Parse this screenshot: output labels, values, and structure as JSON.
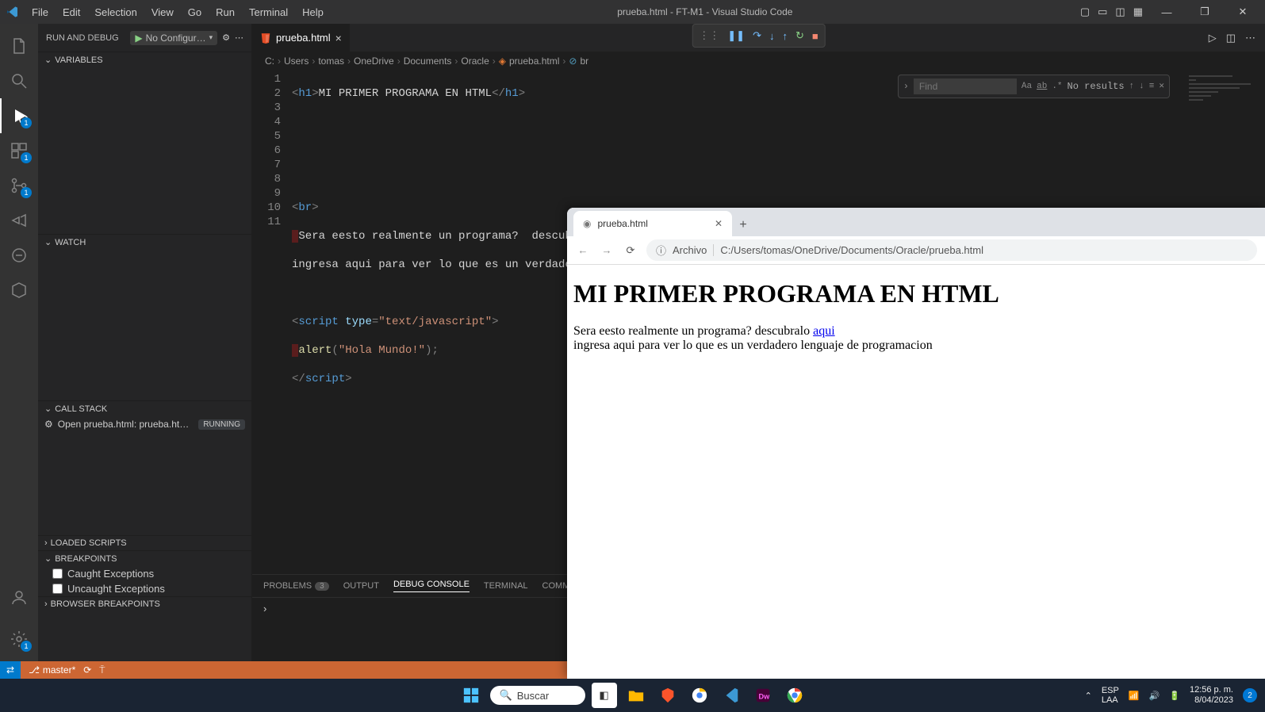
{
  "titlebar": {
    "menu": [
      "File",
      "Edit",
      "Selection",
      "View",
      "Go",
      "Run",
      "Terminal",
      "Help"
    ],
    "title": "prueba.html - FT-M1 - Visual Studio Code"
  },
  "sidebar": {
    "title": "RUN AND DEBUG",
    "config": "No Configur…",
    "sections": {
      "variables": "VARIABLES",
      "watch": "WATCH",
      "callstack": "CALL STACK",
      "callstack_item": "Open prueba.html: prueba.ht…",
      "callstack_status": "RUNNING",
      "loaded": "LOADED SCRIPTS",
      "breakpoints": "BREAKPOINTS",
      "caught": "Caught Exceptions",
      "uncaught": "Uncaught Exceptions",
      "browser_bp": "BROWSER BREAKPOINTS"
    }
  },
  "tab": {
    "name": "prueba.html"
  },
  "breadcrumb": [
    "C:",
    "Users",
    "tomas",
    "OneDrive",
    "Documents",
    "Oracle",
    "prueba.html",
    "br"
  ],
  "find": {
    "placeholder": "Find",
    "results": "No results"
  },
  "code": {
    "lines": [
      1,
      2,
      3,
      4,
      5,
      6,
      7,
      8,
      9,
      10,
      11
    ],
    "h1_text": "MI PRIMER PROGRAMA EN HTML",
    "line6_pre": "Sera eesto realmente un programa?  descubralo ",
    "href": "https://es.wikipedia.org/wiki/Python",
    "link_text": "aqui",
    "line7": "ingresa aqui para ver lo que es un verdadero lenguaje de programacion",
    "script_type": "text/javascript",
    "alert_arg": "Hola Mundo!"
  },
  "panel": {
    "problems": "PROBLEMS",
    "problems_badge": "3",
    "output": "OUTPUT",
    "debug": "DEBUG CONSOLE",
    "terminal": "TERMINAL",
    "comments": "COMMENTS"
  },
  "statusbar": {
    "branch": "master*"
  },
  "browser": {
    "tab_title": "prueba.html",
    "scheme": "Archivo",
    "url": "C:/Users/tomas/OneDrive/Documents/Oracle/prueba.html",
    "h1": "MI PRIMER PROGRAMA EN HTML",
    "p1a": "Sera eesto realmente un programa? descubralo ",
    "p1_link": "aqui",
    "p2": "ingresa aqui para ver lo que es un verdadero lenguaje de programacion"
  },
  "taskbar": {
    "search": "Buscar",
    "lang1": "ESP",
    "lang2": "LAA",
    "time": "12:56 p. m.",
    "date": "8/04/2023",
    "notif": "2"
  }
}
